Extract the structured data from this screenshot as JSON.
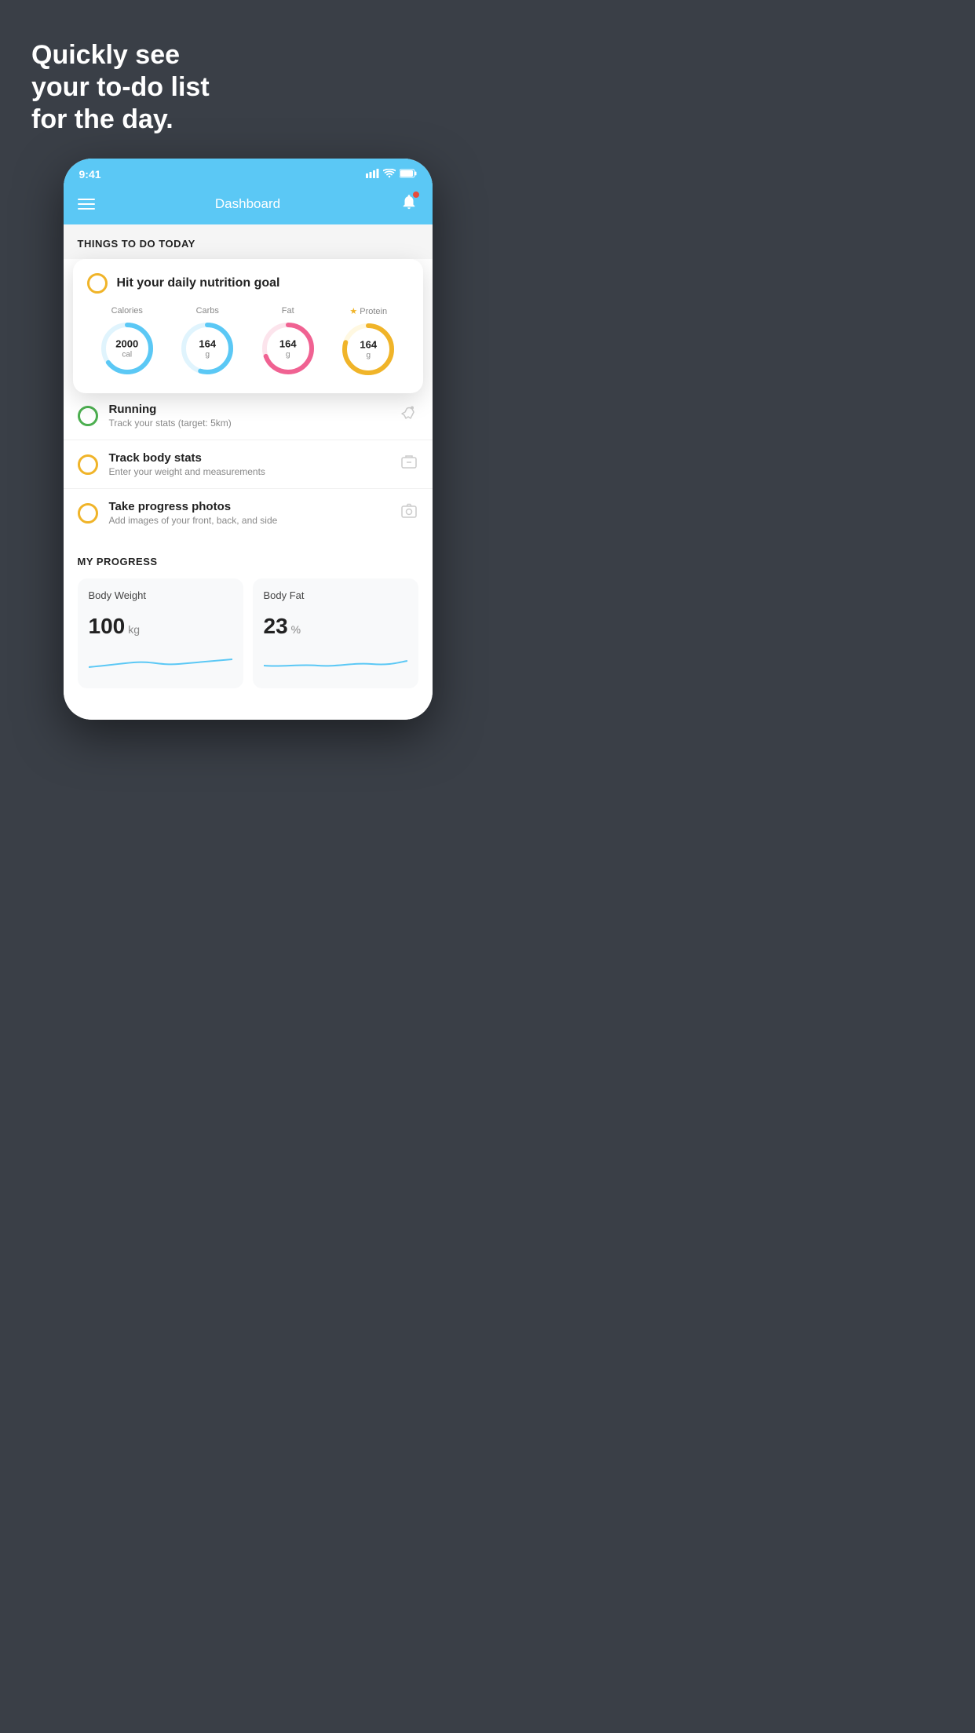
{
  "headline": {
    "line1": "Quickly see",
    "line2": "your to-do list",
    "line3": "for the day."
  },
  "statusBar": {
    "time": "9:41",
    "signal": "▌▌▌",
    "wifi": "wifi",
    "battery": "battery"
  },
  "navbar": {
    "title": "Dashboard"
  },
  "sectionHeader": {
    "title": "THINGS TO DO TODAY"
  },
  "featuredCard": {
    "title": "Hit your daily nutrition goal",
    "nutrition": [
      {
        "label": "Calories",
        "value": "2000",
        "unit": "cal",
        "color": "#5bc8f5",
        "trackColor": "#e0f4fd",
        "progress": 65
      },
      {
        "label": "Carbs",
        "value": "164",
        "unit": "g",
        "color": "#5bc8f5",
        "trackColor": "#e0f4fd",
        "progress": 55
      },
      {
        "label": "Fat",
        "value": "164",
        "unit": "g",
        "color": "#f06292",
        "trackColor": "#fce4ec",
        "progress": 70
      },
      {
        "label": "Protein",
        "value": "164",
        "unit": "g",
        "color": "#f0b429",
        "trackColor": "#fff8e1",
        "progress": 80,
        "starred": true
      }
    ]
  },
  "todoItems": [
    {
      "title": "Running",
      "subtitle": "Track your stats (target: 5km)",
      "circleColor": "green",
      "icon": "shoe"
    },
    {
      "title": "Track body stats",
      "subtitle": "Enter your weight and measurements",
      "circleColor": "yellow",
      "icon": "scale"
    },
    {
      "title": "Take progress photos",
      "subtitle": "Add images of your front, back, and side",
      "circleColor": "yellow",
      "icon": "photo"
    }
  ],
  "progressSection": {
    "title": "MY PROGRESS",
    "cards": [
      {
        "title": "Body Weight",
        "value": "100",
        "unit": "kg"
      },
      {
        "title": "Body Fat",
        "value": "23",
        "unit": "%"
      }
    ]
  }
}
